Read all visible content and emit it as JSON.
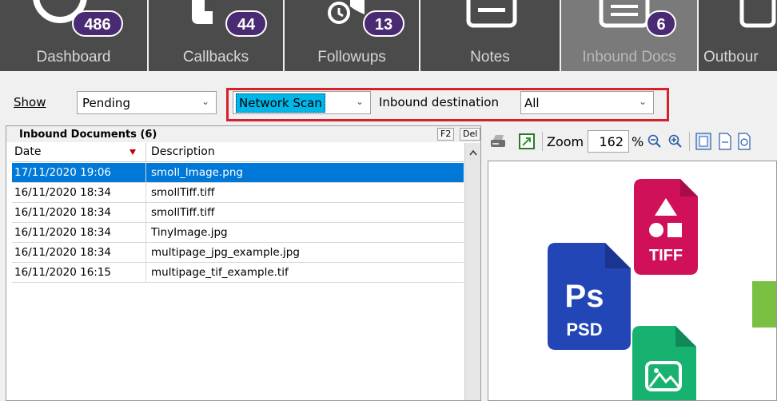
{
  "tabs": [
    {
      "label": "Dashboard",
      "badge": "486",
      "icon": "dashboard-icon"
    },
    {
      "label": "Callbacks",
      "badge": "44",
      "icon": "phone-icon"
    },
    {
      "label": "Followups",
      "badge": "13",
      "icon": "alarm-clock-icon"
    },
    {
      "label": "Notes",
      "badge": "",
      "icon": "notes-icon"
    },
    {
      "label": "Inbound Docs",
      "badge": "6",
      "icon": "inbound-docs-icon",
      "active": true
    },
    {
      "label": "Outbour",
      "badge": "",
      "icon": "outbound-docs-icon"
    }
  ],
  "filters": {
    "show_label": "Show",
    "show_value": "Pending",
    "source_value": "Network Scan",
    "destination_label": "Inbound destination",
    "destination_value": "All"
  },
  "list": {
    "title": "Inbound Documents (6)",
    "key_f2": "F2",
    "key_del": "Del",
    "columns": {
      "date": "Date",
      "description": "Description"
    },
    "rows": [
      {
        "date": "17/11/2020 19:06",
        "description": "smoll_Image.png",
        "selected": true
      },
      {
        "date": "16/11/2020 18:34",
        "description": "smollTiff.tiff"
      },
      {
        "date": "16/11/2020 18:34",
        "description": "smollTiff.tiff"
      },
      {
        "date": "16/11/2020 18:34",
        "description": "TinyImage.jpg"
      },
      {
        "date": "16/11/2020 18:34",
        "description": "multipage_jpg_example.jpg"
      },
      {
        "date": "16/11/2020 16:15",
        "description": "multipage_tif_example.tif"
      }
    ]
  },
  "viewer": {
    "zoom_label": "Zoom",
    "zoom_value": "162",
    "zoom_unit": "%",
    "preview": {
      "psd_logo": "Ps",
      "psd_label": "PSD",
      "tiff_label": "TIFF"
    }
  },
  "colors": {
    "tab_bg": "#4b4b4b",
    "tab_active_bg": "#7a7a7a",
    "badge_bg": "#4a2a72",
    "selection": "#0078d7",
    "highlight_combo": "#00b7e8",
    "red_frame": "#d8202a"
  }
}
